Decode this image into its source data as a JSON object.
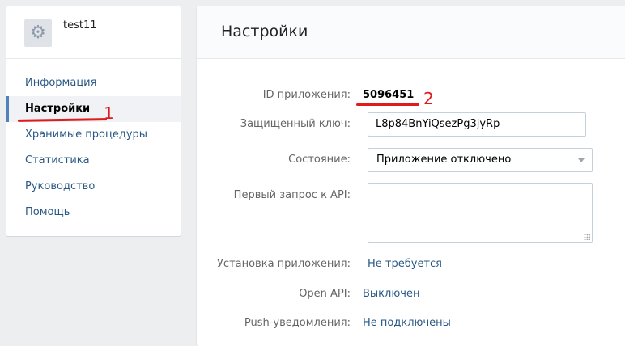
{
  "app": {
    "name": "test11",
    "icon": "gear-icon"
  },
  "sidebar": {
    "items": [
      {
        "label": "Информация"
      },
      {
        "label": "Настройки",
        "active": true
      },
      {
        "label": "Хранимые процедуры"
      },
      {
        "label": "Статистика"
      },
      {
        "label": "Руководство"
      },
      {
        "label": "Помощь"
      }
    ]
  },
  "main": {
    "title": "Настройки",
    "fields": {
      "app_id": {
        "label": "ID приложения:",
        "value": "5096451"
      },
      "secret_key": {
        "label": "Защищенный ключ:",
        "value": "L8p84BnYiQsezPg3jyRp"
      },
      "state": {
        "label": "Состояние:",
        "value": "Приложение отключено"
      },
      "first_api_request": {
        "label": "Первый запрос к API:",
        "value": ""
      },
      "installation": {
        "label": "Установка приложения:",
        "value": "Не требуется"
      },
      "open_api": {
        "label": "Open API:",
        "value": "Выключен"
      },
      "push": {
        "label": "Push-уведомления:",
        "value": "Не подключены"
      }
    }
  },
  "annotations": {
    "mark1": "1",
    "mark2": "2"
  },
  "colors": {
    "link": "#2a5885",
    "accent": "#5181b8",
    "annotation": "#e01b1b"
  }
}
